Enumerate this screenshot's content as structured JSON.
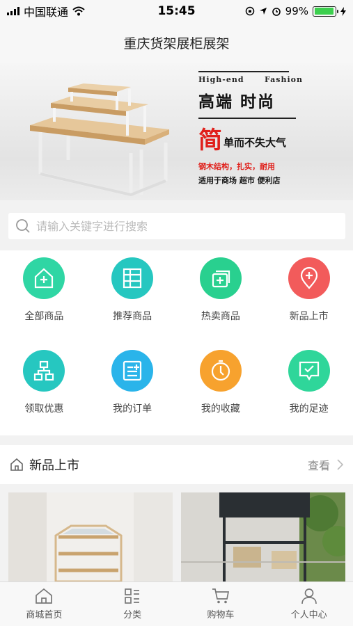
{
  "status_bar": {
    "carrier": "中国联通",
    "time": "15:45",
    "battery": "99%"
  },
  "header": {
    "title": "重庆货架展柜展架"
  },
  "banner": {
    "en_left": "High-end",
    "en_right": "Fashion",
    "cn_title": "高端 时尚",
    "jian_char": "简",
    "jian_text": "单而不失大气",
    "red_line": "钢木结构，扎实，耐用",
    "black_line": "适用于商场 超市 便利店"
  },
  "search": {
    "placeholder": "请输入关键字进行搜索"
  },
  "categories": [
    {
      "label": "全部商品",
      "icon": "home-plus-icon",
      "color": "#2fd6a4"
    },
    {
      "label": "推荐商品",
      "icon": "shelf-icon",
      "color": "#26c7c0"
    },
    {
      "label": "热卖商品",
      "icon": "cards-plus-icon",
      "color": "#29d08f"
    },
    {
      "label": "新品上市",
      "icon": "location-plus-icon",
      "color": "#f25b5b"
    },
    {
      "label": "领取优惠",
      "icon": "org-chart-icon",
      "color": "#26c7c0"
    },
    {
      "label": "我的订单",
      "icon": "order-list-icon",
      "color": "#2ab4ea"
    },
    {
      "label": "我的收藏",
      "icon": "clock-dial-icon",
      "color": "#f7a22e"
    },
    {
      "label": "我的足迹",
      "icon": "chat-check-icon",
      "color": "#2fd69a"
    }
  ],
  "section": {
    "title": "新品上市",
    "more": "查看"
  },
  "tabbar": [
    {
      "label": "商城首页",
      "icon": "home-icon"
    },
    {
      "label": "分类",
      "icon": "category-icon"
    },
    {
      "label": "购物车",
      "icon": "cart-icon"
    },
    {
      "label": "个人中心",
      "icon": "user-icon"
    }
  ]
}
